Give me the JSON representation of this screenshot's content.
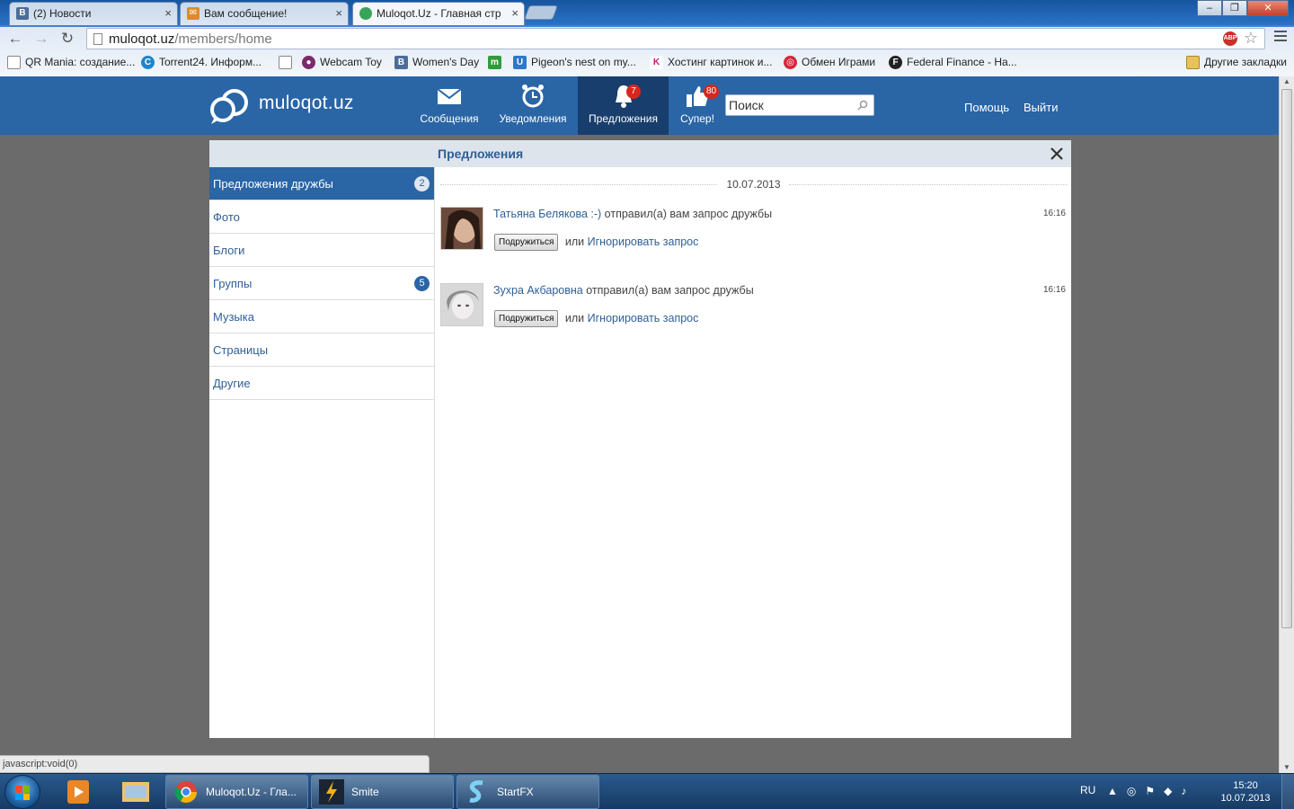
{
  "browser": {
    "tabs": [
      {
        "title": "(2) Новости",
        "favicon": "vk-icon",
        "active": false
      },
      {
        "title": "Вам сообщение!",
        "favicon": "mail-icon",
        "active": false
      },
      {
        "title": "Muloqot.Uz - Главная стр",
        "favicon": "muloqot-icon",
        "active": true
      }
    ],
    "close_glyph": "×",
    "url_domain": "muloqot.uz",
    "url_path": "/members/home",
    "abp_label": "ABP",
    "bookmarks": [
      {
        "label": "QR Mania: создание...",
        "icon": "bookmark-page-icon"
      },
      {
        "label": "Torrent24. Информ...",
        "icon": "torrent-icon"
      },
      {
        "label": "",
        "icon": "blank-page-icon"
      },
      {
        "label": "Webcam Toy",
        "icon": "webcam-icon"
      },
      {
        "label": "Women's Day",
        "icon": "vk-icon"
      },
      {
        "label": "",
        "icon": "green-m-icon"
      },
      {
        "label": "Pigeon's nest on my...",
        "icon": "u-icon"
      },
      {
        "label": "Хостинг картинок и...",
        "icon": "k-icon"
      },
      {
        "label": "Обмен Играми",
        "icon": "target-icon"
      },
      {
        "label": "Federal Finance - На...",
        "icon": "federal-icon"
      },
      {
        "label": "Другие закладки",
        "icon": "folder-icon"
      }
    ]
  },
  "site": {
    "logo_text": "muloqot.uz",
    "nav": [
      {
        "label": "Сообщения",
        "icon": "envelope-icon",
        "badge": ""
      },
      {
        "label": "Уведомления",
        "icon": "alarm-clock-icon",
        "badge": ""
      },
      {
        "label": "Предложения",
        "icon": "bell-icon",
        "badge": "7"
      },
      {
        "label": "Супер!",
        "icon": "thumbs-up-icon",
        "badge": "80"
      }
    ],
    "search_placeholder": "Поиск",
    "help_label": "Помощь",
    "logout_label": "Выйти"
  },
  "modal": {
    "title": "Предложения",
    "sidebar": [
      {
        "label": "Предложения дружбы",
        "count": "2",
        "active": true
      },
      {
        "label": "Фото",
        "count": ""
      },
      {
        "label": "Блоги",
        "count": ""
      },
      {
        "label": "Группы",
        "count": "5"
      },
      {
        "label": "Музыка",
        "count": ""
      },
      {
        "label": "Страницы",
        "count": ""
      },
      {
        "label": "Другие",
        "count": ""
      }
    ],
    "date": "10.07.2013",
    "requests": [
      {
        "name": "Татьяна Белякова :-)",
        "text": " отправил(а) вам запрос дружбы",
        "time": "16:16",
        "accept_label": "Подружиться",
        "or_text": "или",
        "ignore_label": "Игнорировать запрос"
      },
      {
        "name": "Зухра Акбаровна",
        "text": " отправил(а) вам запрос дружбы",
        "time": "16:16",
        "accept_label": "Подружиться",
        "or_text": "или",
        "ignore_label": "Игнорировать запрос"
      }
    ]
  },
  "status_bar": "javascript:void(0)",
  "taskbar": {
    "tasks": [
      {
        "label": "Muloqot.Uz - Гла...",
        "icon": "chrome-icon"
      },
      {
        "label": "Smite",
        "icon": "smite-icon"
      },
      {
        "label": "StartFX",
        "icon": "startfx-icon"
      }
    ],
    "lang": "RU",
    "time": "15:20",
    "date": "10.07.2013"
  },
  "colors": {
    "brand": "#2a65a6",
    "brand_dark": "#183e6d",
    "badge": "#d9261c",
    "link": "#2f5f96"
  }
}
